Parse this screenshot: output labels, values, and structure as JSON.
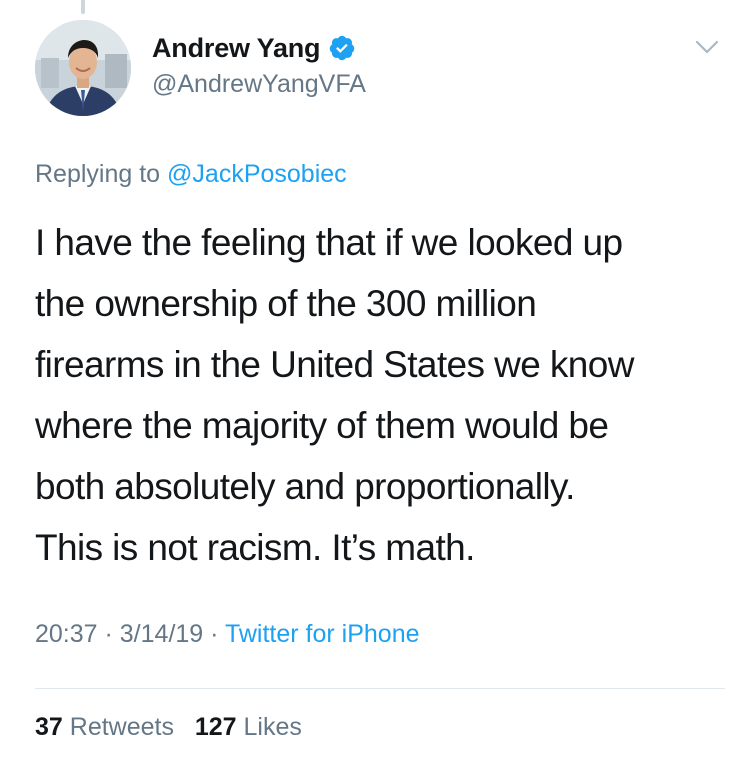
{
  "author": {
    "name": "Andrew Yang",
    "handle": "@AndrewYangVFA",
    "verified": true
  },
  "reply": {
    "prefix": "Replying to ",
    "handle": "@JackPosobiec"
  },
  "tweet": {
    "lines": [
      "I have the feeling that if we looked up",
      "the ownership of the 300 million",
      "firearms in the United States we know",
      "where the majority of them would be",
      "both absolutely and proportionally.",
      "This is not racism.  It’s math."
    ]
  },
  "meta": {
    "time": "20:37",
    "sep1": " · ",
    "date": "3/14/19",
    "sep2": " · ",
    "source": "Twitter for iPhone"
  },
  "stats": {
    "retweets_count": "37",
    "retweets_label": " Retweets",
    "likes_count": "127",
    "likes_label": " Likes"
  },
  "icons": {
    "verified": "verified-badge-icon",
    "menu": "chevron-down-icon",
    "avatar": "profile-photo"
  },
  "colors": {
    "link": "#1da1f2",
    "secondary_text": "#657786",
    "primary_text": "#14171a",
    "divider": "#e1e8ed"
  }
}
